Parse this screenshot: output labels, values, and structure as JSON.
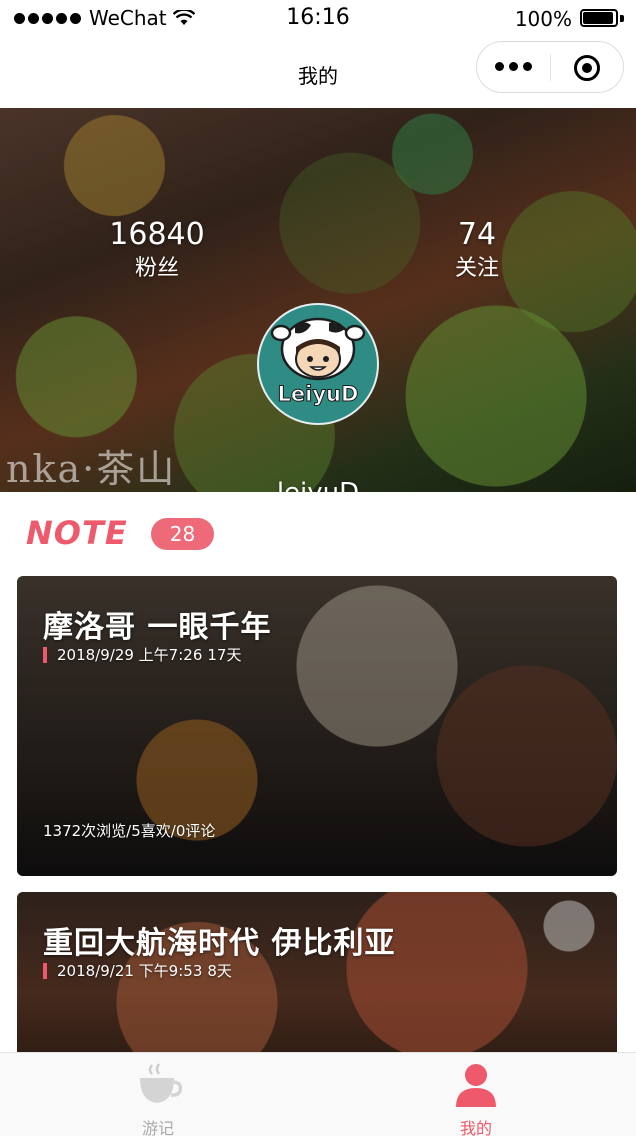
{
  "status_bar": {
    "carrier": "WeChat",
    "time": "16:16",
    "battery": "100%"
  },
  "nav": {
    "title": "我的"
  },
  "profile": {
    "fans_count": "16840",
    "fans_label": "粉丝",
    "follow_count": "74",
    "follow_label": "关注",
    "username": "leiyuD",
    "avatar_text": "LeiyuD"
  },
  "hero": {
    "caption_art": "nka·茶山"
  },
  "notes": {
    "title": "NOTE",
    "count": "28",
    "items": [
      {
        "title": "摩洛哥 一眼千年",
        "date": "2018/9/29 上午7:26",
        "days": "17天",
        "stats": "1372次浏览/5喜欢/0评论"
      },
      {
        "title": "重回大航海时代 伊比利亚",
        "date": "2018/9/21 下午9:53",
        "days": "8天"
      }
    ]
  },
  "tab_bar": {
    "items": [
      {
        "label": "游记",
        "icon": "coffee-cup-icon",
        "active": false
      },
      {
        "label": "我的",
        "icon": "person-icon",
        "active": true
      }
    ]
  },
  "colors": {
    "accent": "#ee5a6b",
    "badge": "#ee6a78",
    "avatar_bg": "#2e8c84"
  }
}
